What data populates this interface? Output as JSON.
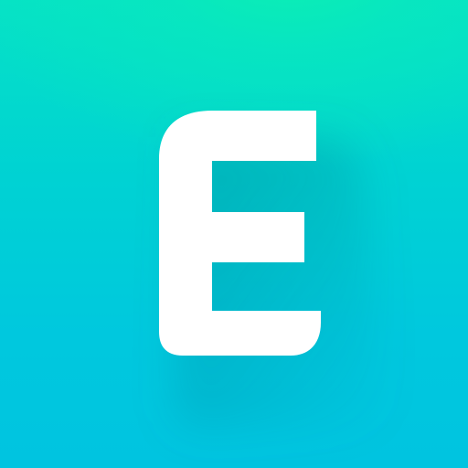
{
  "app_icon": {
    "glyph": "E",
    "icon_name": "letter-e-logo-icon",
    "colors": {
      "background_top": "#0cf0b2",
      "background_mid": "#00d2d3",
      "background_bottom": "#00c4e0",
      "glyph": "#ffffff"
    }
  }
}
